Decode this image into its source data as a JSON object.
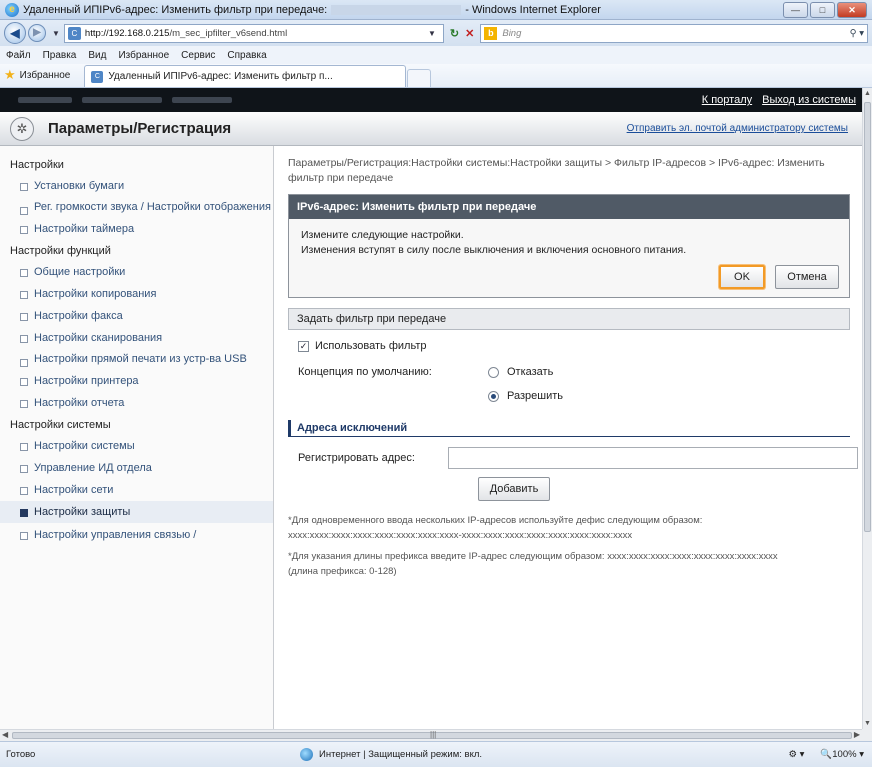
{
  "window": {
    "title_prefix": "Удаленный ИПIPv6-адрес: Изменить фильтр при передаче:",
    "title_suffix": "- Windows Internet Explorer",
    "minimize": "—",
    "maximize": "□",
    "close": "✕"
  },
  "address": {
    "url_host": "http://192.168.0.215",
    "url_path": "/m_sec_ipfilter_v6send.html",
    "search_placeholder": "Bing"
  },
  "menu": [
    "Файл",
    "Правка",
    "Вид",
    "Избранное",
    "Сервис",
    "Справка"
  ],
  "favorites": {
    "label": "Избранное",
    "tab_title": "Удаленный ИПIPv6-адрес: Изменить фильтр п..."
  },
  "top_links": {
    "portal": "К порталу",
    "logout": "Выход из системы"
  },
  "header": {
    "title": "Параметры/Регистрация",
    "mail_link": "Отправить эл. почтой администратору системы"
  },
  "sidebar": {
    "group_settings": "Настройки",
    "settings_items": [
      "Установки бумаги",
      "Рег. громкости звука / Настройки отображения",
      "Настройки таймера"
    ],
    "group_functions": "Настройки функций",
    "function_items": [
      "Общие настройки",
      "Настройки копирования",
      "Настройки факса",
      "Настройки сканирования",
      "Настройки прямой печати из устр-ва USB",
      "Настройки принтера",
      "Настройки отчета"
    ],
    "group_system": "Настройки системы",
    "system_items": [
      "Настройки системы",
      "Управление ИД отдела",
      "Настройки сети",
      "Настройки защиты",
      "Настройки управления связью /"
    ]
  },
  "main": {
    "breadcrumb": "Параметры/Регистрация:Настройки системы:Настройки защиты > Фильтр IP-адресов > IPv6-адрес: Изменить фильтр при передаче",
    "dialog_title": "IPv6-адрес: Изменить фильтр при передаче",
    "dialog_line1": "Измените следующие настройки.",
    "dialog_line2": "Изменения вступят в силу после выключения и включения основного питания.",
    "ok": "OK",
    "cancel": "Отмена",
    "section_title": "Задать фильтр при передаче",
    "use_filter": "Использовать фильтр",
    "default_policy_label": "Концепция по умолчанию:",
    "option_deny": "Отказать",
    "option_allow": "Разрешить",
    "exceptions_title": "Адреса исключений",
    "register_label": "Регистрировать адрес:",
    "add": "Добавить",
    "note1": "*Для одновременного ввода нескольких IP-адресов используйте дефис следующим образом:",
    "note1b": "xxxx:xxxx:xxxx:xxxx:xxxx:xxxx:xxxx:xxxx-xxxx:xxxx:xxxx:xxxx:xxxx:xxxx:xxxx:xxxx",
    "note2": "*Для указания длины префикса введите IP-адрес следующим образом: xxxx:xxxx:xxxx:xxxx:xxxx:xxxx:xxxx:xxxx",
    "note2b": "(длина префикса: 0-128)"
  },
  "status": {
    "ready": "Готово",
    "zone": "Интернет | Защищенный режим: вкл.",
    "zoom": "100%"
  }
}
